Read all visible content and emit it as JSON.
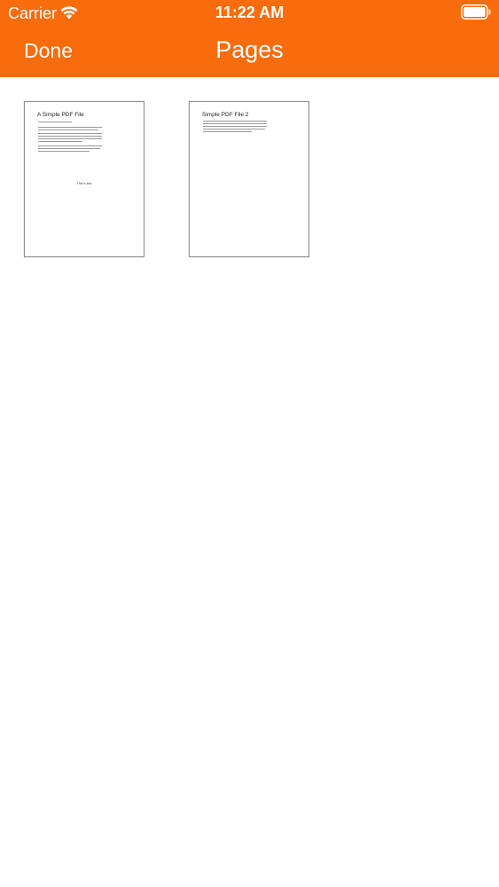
{
  "status_bar": {
    "carrier": "Carrier",
    "time": "11:22 AM",
    "wifi_icon": "wifi-icon",
    "battery_icon": "battery-icon"
  },
  "nav": {
    "done_label": "Done",
    "title": "Pages"
  },
  "pages": [
    {
      "title": "A Simple PDF File",
      "footer": "This is text"
    },
    {
      "title": "Simple PDF File 2"
    }
  ],
  "colors": {
    "accent": "#f76c0c",
    "background": "#ffffff",
    "thumb_border": "#8f8f8f"
  }
}
